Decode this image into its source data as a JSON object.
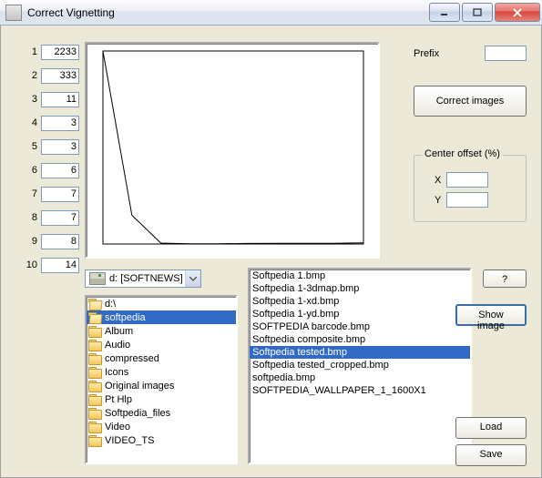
{
  "window": {
    "title": "Correct Vignetting"
  },
  "numbers": [
    {
      "idx": "1",
      "val": "2233"
    },
    {
      "idx": "2",
      "val": "333"
    },
    {
      "idx": "3",
      "val": "11"
    },
    {
      "idx": "4",
      "val": "3"
    },
    {
      "idx": "5",
      "val": "3"
    },
    {
      "idx": "6",
      "val": "6"
    },
    {
      "idx": "7",
      "val": "7"
    },
    {
      "idx": "8",
      "val": "7"
    },
    {
      "idx": "9",
      "val": "8"
    },
    {
      "idx": "10",
      "val": "14"
    }
  ],
  "prefix": {
    "label": "Prefix",
    "value": ""
  },
  "buttons": {
    "correct": "Correct images",
    "q": "?",
    "show": "Show image",
    "load": "Load",
    "save": "Save"
  },
  "offset": {
    "legend": "Center offset (%)",
    "x_label": "X",
    "y_label": "Y",
    "x": "",
    "y": ""
  },
  "drive": {
    "label": "d: [SOFTNEWS]"
  },
  "tree": [
    {
      "label": "d:\\",
      "indent": 0,
      "open": true,
      "sel": false
    },
    {
      "label": "softpedia",
      "indent": 1,
      "open": true,
      "sel": true
    },
    {
      "label": "Album",
      "indent": 2,
      "open": false,
      "sel": false
    },
    {
      "label": "Audio",
      "indent": 2,
      "open": false,
      "sel": false
    },
    {
      "label": "compressed",
      "indent": 2,
      "open": false,
      "sel": false
    },
    {
      "label": "Icons",
      "indent": 2,
      "open": false,
      "sel": false
    },
    {
      "label": "Original images",
      "indent": 2,
      "open": false,
      "sel": false
    },
    {
      "label": "Pt Hlp",
      "indent": 2,
      "open": false,
      "sel": false
    },
    {
      "label": "Softpedia_files",
      "indent": 2,
      "open": false,
      "sel": false
    },
    {
      "label": "Video",
      "indent": 2,
      "open": false,
      "sel": false
    },
    {
      "label": "VIDEO_TS",
      "indent": 2,
      "open": false,
      "sel": false
    }
  ],
  "files": [
    {
      "name": "Softpedia 1.bmp",
      "sel": false
    },
    {
      "name": "Softpedia 1-3dmap.bmp",
      "sel": false
    },
    {
      "name": "Softpedia 1-xd.bmp",
      "sel": false
    },
    {
      "name": "Softpedia 1-yd.bmp",
      "sel": false
    },
    {
      "name": "SOFTPEDIA barcode.bmp",
      "sel": false
    },
    {
      "name": "Softpedia composite.bmp",
      "sel": false
    },
    {
      "name": "Softpedia tested.bmp",
      "sel": true
    },
    {
      "name": "Softpedia tested_cropped.bmp",
      "sel": false
    },
    {
      "name": "softpedia.bmp",
      "sel": false
    },
    {
      "name": "SOFTPEDIA_WALLPAPER_1_1600X1",
      "sel": false
    }
  ],
  "chart_data": {
    "type": "line",
    "title": "",
    "xlabel": "",
    "ylabel": "",
    "x": [
      1,
      2,
      3,
      4,
      5,
      6,
      7,
      8,
      9,
      10
    ],
    "values": [
      2233,
      333,
      11,
      3,
      3,
      6,
      7,
      7,
      8,
      14
    ],
    "xlim": [
      1,
      10
    ],
    "ylim": [
      0,
      2233
    ]
  }
}
